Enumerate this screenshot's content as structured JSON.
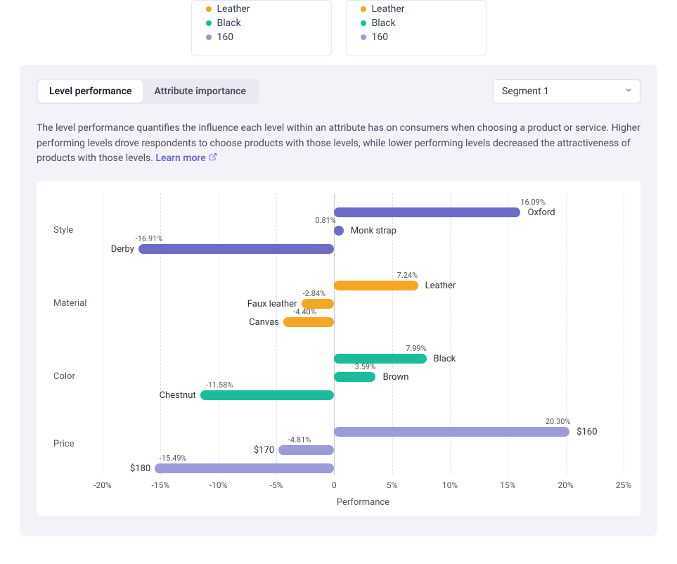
{
  "cards": [
    {
      "rows": [
        {
          "dot": "orange",
          "label": "Leather"
        },
        {
          "dot": "teal",
          "label": "Black"
        },
        {
          "dot": "violet",
          "label": "160"
        }
      ]
    },
    {
      "rows": [
        {
          "dot": "orange",
          "label": "Leather"
        },
        {
          "dot": "teal",
          "label": "Black"
        },
        {
          "dot": "violet",
          "label": "160"
        }
      ]
    }
  ],
  "tabs": {
    "t1": "Level performance",
    "t2": "Attribute importance"
  },
  "segment_select": "Segment 1",
  "description": "The level performance quantifies the influence each level within an attribute has on consumers when choosing a product or service. Higher performing levels drove respondents to choose products with those levels, while lower performing levels decreased the attractiveness of products with those levels.",
  "learn_more": "Learn more",
  "xlabel": "Performance",
  "xticks": [
    "-20%",
    "-15%",
    "-10%",
    "-5%",
    "0",
    "5%",
    "10%",
    "15%",
    "20%",
    "25%"
  ],
  "cats": {
    "style": "Style",
    "material": "Material",
    "color": "Color",
    "price": "Price"
  },
  "bars": {
    "oxford": {
      "label": "Oxford",
      "val": "16.09%"
    },
    "monk": {
      "label": "Monk strap",
      "val": "0.81%"
    },
    "derby": {
      "label": "Derby",
      "val": "-16.91%"
    },
    "leather": {
      "label": "Leather",
      "val": "7.24%"
    },
    "faux": {
      "label": "Faux leather",
      "val": "-2.84%"
    },
    "canvas": {
      "label": "Canvas",
      "val": "-4.40%"
    },
    "black": {
      "label": "Black",
      "val": "7.99%"
    },
    "brown": {
      "label": "Brown",
      "val": "3.59%"
    },
    "chestnut": {
      "label": "Chestnut",
      "val": "-11.58%"
    },
    "p160": {
      "label": "$160",
      "val": "20.30%"
    },
    "p170": {
      "label": "$170",
      "val": "-4.81%"
    },
    "p180": {
      "label": "$180",
      "val": "-15.49%"
    }
  },
  "chart_data": {
    "type": "bar",
    "orientation": "horizontal",
    "title": "",
    "xlabel": "Performance",
    "ylabel": "",
    "xlim": [
      -20,
      25
    ],
    "grid": true,
    "attributes": [
      {
        "name": "Style",
        "color": "#6e6bc7",
        "levels": [
          {
            "label": "Oxford",
            "value": 16.09
          },
          {
            "label": "Monk strap",
            "value": 0.81
          },
          {
            "label": "Derby",
            "value": -16.91
          }
        ]
      },
      {
        "name": "Material",
        "color": "#f5a623",
        "levels": [
          {
            "label": "Leather",
            "value": 7.24
          },
          {
            "label": "Faux leather",
            "value": -2.84
          },
          {
            "label": "Canvas",
            "value": -4.4
          }
        ]
      },
      {
        "name": "Color",
        "color": "#1abc9c",
        "levels": [
          {
            "label": "Black",
            "value": 7.99
          },
          {
            "label": "Brown",
            "value": 3.59
          },
          {
            "label": "Chestnut",
            "value": -11.58
          }
        ]
      },
      {
        "name": "Price",
        "color": "#9b9bd6",
        "levels": [
          {
            "label": "$160",
            "value": 20.3
          },
          {
            "label": "$170",
            "value": -4.81
          },
          {
            "label": "$180",
            "value": -15.49
          }
        ]
      }
    ]
  }
}
